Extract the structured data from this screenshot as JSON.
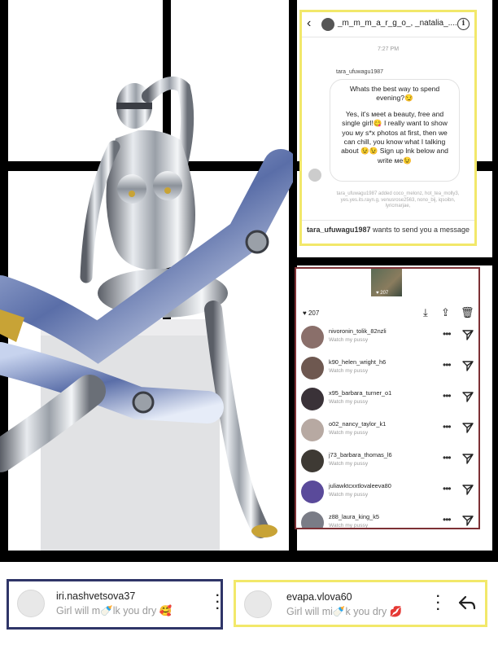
{
  "dm": {
    "back_icon": "back-arrow-icon",
    "title": "_m_m_m_a_r_g_o_, _natalia_....",
    "time": "7:27 PM",
    "sender": "tara_ufuwagu1987",
    "message_p1": "Whats the best way to spend evening?😏",
    "message_p2": "Yes, it's мeet a beauty, free and single girl!😋 I really want to show you мy s*x photos at first, then we can chill, you know what I talking about 😉😉 Sign up lnk below and write мe😉",
    "added_text": "tara_ufuwagu1987 added coco_melonz, hot_tea_molly3, yes.yes.its.rayn.g, venusrose2563, nono_bij, iqsoibn, lyricmarjae,",
    "request_user": "tara_ufuwagu1987",
    "request_text": " wants to send you a message"
  },
  "post": {
    "thumb_count": "♥ 207",
    "likes": "♥ 207",
    "users": [
      {
        "name": "nivoronin_tolik_82nzli",
        "sub": "Watch my pussy",
        "color": "#8a6f6a"
      },
      {
        "name": "k90_helen_wright_h6",
        "sub": "Watch my pussy",
        "color": "#6e5850"
      },
      {
        "name": "x95_barbara_turner_o1",
        "sub": "Watch my pussy",
        "color": "#3a3238"
      },
      {
        "name": "o02_nancy_taylor_k1",
        "sub": "Watch my pussy",
        "color": "#b7a9a2"
      },
      {
        "name": "j73_barbara_thomas_l6",
        "sub": "Watch my pussy",
        "color": "#3e3a34"
      },
      {
        "name": "juliawktcxxtlovaleeva80",
        "sub": "Watch my pussy",
        "color": "#5a4a9a"
      },
      {
        "name": "z88_laura_king_k5",
        "sub": "Watch my pussy",
        "color": "#7a7c86"
      }
    ]
  },
  "comments": [
    {
      "name": "iri.nashvetsova37",
      "text": "Girl will m🍼lk you dry 🥰"
    },
    {
      "name": "evapa.vlova60",
      "text": "Girl will mi🍼k you dry 💋"
    }
  ],
  "colors": {
    "yellow_border": "#f2e86a",
    "red_border": "#7d3035",
    "navy_border": "#2f3568"
  }
}
